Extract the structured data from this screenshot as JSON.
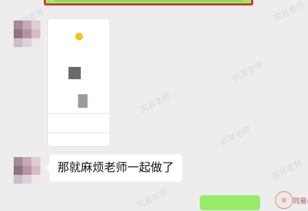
{
  "watermark": {
    "text": "同易老师"
  },
  "messages": {
    "top_highlight": {
      "text": "",
      "highlight_color": "#d8302b",
      "bubble_color": "#95ec69"
    },
    "screenshot_card": {
      "header_text": "",
      "rows": [
        "",
        "",
        "",
        ""
      ]
    },
    "text_reply": {
      "text": "那就麻烦老师一起做了"
    },
    "outgoing_partial": {
      "text": ""
    }
  },
  "colors": {
    "chat_bg": "#ededed",
    "incoming_bubble": "#ffffff",
    "outgoing_bubble": "#95ec69"
  }
}
